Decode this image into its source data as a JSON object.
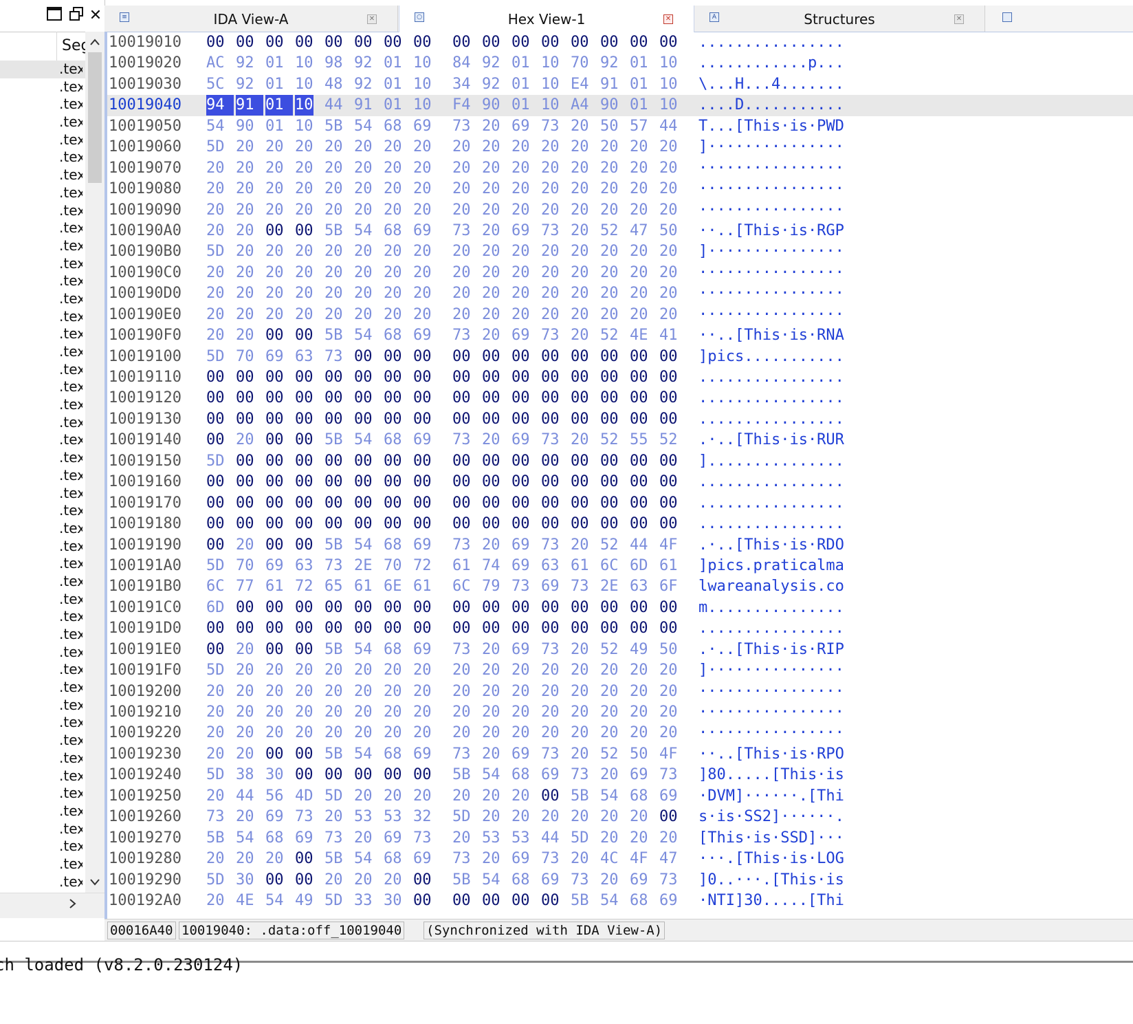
{
  "left_panel": {
    "column_header": "Seg",
    "segment_label": ".tex",
    "row_count": 47,
    "selected_index": 0,
    "toolbar": {
      "window_icon": "window-icon",
      "restore_icon": "restore-icon",
      "close_label": "✕"
    }
  },
  "tabs": [
    {
      "label": "IDA View-A",
      "icon": "disassembly-icon",
      "active": false
    },
    {
      "label": "Hex View-1",
      "icon": "hex-icon",
      "active": true
    },
    {
      "label": "Structures",
      "icon": "structures-icon",
      "active": false
    }
  ],
  "hex_view": {
    "highlighted_address": "10019040",
    "selected_bytes": 4,
    "rows": [
      {
        "addr": "10019010",
        "bytes": "00 00 00 00 00 00 00 00 00 00 00 00 00 00 00 00",
        "ascii": "................"
      },
      {
        "addr": "10019020",
        "bytes": "AC 92 01 10 98 92 01 10 84 92 01 10 70 92 01 10",
        "ascii": "............p..."
      },
      {
        "addr": "10019030",
        "bytes": "5C 92 01 10 48 92 01 10 34 92 01 10 E4 91 01 10",
        "ascii": "\\...H...4......."
      },
      {
        "addr": "10019040",
        "bytes": "94 91 01 10 44 91 01 10 F4 90 01 10 A4 90 01 10",
        "ascii": "....D..........."
      },
      {
        "addr": "10019050",
        "bytes": "54 90 01 10 5B 54 68 69 73 20 69 73 20 50 57 44",
        "ascii": "T...[This·is·PWD"
      },
      {
        "addr": "10019060",
        "bytes": "5D 20 20 20 20 20 20 20 20 20 20 20 20 20 20 20",
        "ascii": "]···············"
      },
      {
        "addr": "10019070",
        "bytes": "20 20 20 20 20 20 20 20 20 20 20 20 20 20 20 20",
        "ascii": "················"
      },
      {
        "addr": "10019080",
        "bytes": "20 20 20 20 20 20 20 20 20 20 20 20 20 20 20 20",
        "ascii": "················"
      },
      {
        "addr": "10019090",
        "bytes": "20 20 20 20 20 20 20 20 20 20 20 20 20 20 20 20",
        "ascii": "················"
      },
      {
        "addr": "100190A0",
        "bytes": "20 20 00 00 5B 54 68 69 73 20 69 73 20 52 47 50",
        "ascii": "··..[This·is·RGP"
      },
      {
        "addr": "100190B0",
        "bytes": "5D 20 20 20 20 20 20 20 20 20 20 20 20 20 20 20",
        "ascii": "]···············"
      },
      {
        "addr": "100190C0",
        "bytes": "20 20 20 20 20 20 20 20 20 20 20 20 20 20 20 20",
        "ascii": "················"
      },
      {
        "addr": "100190D0",
        "bytes": "20 20 20 20 20 20 20 20 20 20 20 20 20 20 20 20",
        "ascii": "················"
      },
      {
        "addr": "100190E0",
        "bytes": "20 20 20 20 20 20 20 20 20 20 20 20 20 20 20 20",
        "ascii": "················"
      },
      {
        "addr": "100190F0",
        "bytes": "20 20 00 00 5B 54 68 69 73 20 69 73 20 52 4E 41",
        "ascii": "··..[This·is·RNA"
      },
      {
        "addr": "10019100",
        "bytes": "5D 70 69 63 73 00 00 00 00 00 00 00 00 00 00 00",
        "ascii": "]pics..........."
      },
      {
        "addr": "10019110",
        "bytes": "00 00 00 00 00 00 00 00 00 00 00 00 00 00 00 00",
        "ascii": "................"
      },
      {
        "addr": "10019120",
        "bytes": "00 00 00 00 00 00 00 00 00 00 00 00 00 00 00 00",
        "ascii": "................"
      },
      {
        "addr": "10019130",
        "bytes": "00 00 00 00 00 00 00 00 00 00 00 00 00 00 00 00",
        "ascii": "................"
      },
      {
        "addr": "10019140",
        "bytes": "00 20 00 00 5B 54 68 69 73 20 69 73 20 52 55 52",
        "ascii": ".·..[This·is·RUR"
      },
      {
        "addr": "10019150",
        "bytes": "5D 00 00 00 00 00 00 00 00 00 00 00 00 00 00 00",
        "ascii": "]..............."
      },
      {
        "addr": "10019160",
        "bytes": "00 00 00 00 00 00 00 00 00 00 00 00 00 00 00 00",
        "ascii": "................"
      },
      {
        "addr": "10019170",
        "bytes": "00 00 00 00 00 00 00 00 00 00 00 00 00 00 00 00",
        "ascii": "................"
      },
      {
        "addr": "10019180",
        "bytes": "00 00 00 00 00 00 00 00 00 00 00 00 00 00 00 00",
        "ascii": "................"
      },
      {
        "addr": "10019190",
        "bytes": "00 20 00 00 5B 54 68 69 73 20 69 73 20 52 44 4F",
        "ascii": ".·..[This·is·RDO"
      },
      {
        "addr": "100191A0",
        "bytes": "5D 70 69 63 73 2E 70 72 61 74 69 63 61 6C 6D 61",
        "ascii": "]pics.praticalma"
      },
      {
        "addr": "100191B0",
        "bytes": "6C 77 61 72 65 61 6E 61 6C 79 73 69 73 2E 63 6F",
        "ascii": "lwareanalysis.co"
      },
      {
        "addr": "100191C0",
        "bytes": "6D 00 00 00 00 00 00 00 00 00 00 00 00 00 00 00",
        "ascii": "m..............."
      },
      {
        "addr": "100191D0",
        "bytes": "00 00 00 00 00 00 00 00 00 00 00 00 00 00 00 00",
        "ascii": "................"
      },
      {
        "addr": "100191E0",
        "bytes": "00 20 00 00 5B 54 68 69 73 20 69 73 20 52 49 50",
        "ascii": ".·..[This·is·RIP"
      },
      {
        "addr": "100191F0",
        "bytes": "5D 20 20 20 20 20 20 20 20 20 20 20 20 20 20 20",
        "ascii": "]···············"
      },
      {
        "addr": "10019200",
        "bytes": "20 20 20 20 20 20 20 20 20 20 20 20 20 20 20 20",
        "ascii": "················"
      },
      {
        "addr": "10019210",
        "bytes": "20 20 20 20 20 20 20 20 20 20 20 20 20 20 20 20",
        "ascii": "················"
      },
      {
        "addr": "10019220",
        "bytes": "20 20 20 20 20 20 20 20 20 20 20 20 20 20 20 20",
        "ascii": "················"
      },
      {
        "addr": "10019230",
        "bytes": "20 20 00 00 5B 54 68 69 73 20 69 73 20 52 50 4F",
        "ascii": "··..[This·is·RPO"
      },
      {
        "addr": "10019240",
        "bytes": "5D 38 30 00 00 00 00 00 5B 54 68 69 73 20 69 73",
        "ascii": "]80.....[This·is"
      },
      {
        "addr": "10019250",
        "bytes": "20 44 56 4D 5D 20 20 20 20 20 20 00 5B 54 68 69",
        "ascii": "·DVM]······.[Thi"
      },
      {
        "addr": "10019260",
        "bytes": "73 20 69 73 20 53 53 32 5D 20 20 20 20 20 20 00",
        "ascii": "s·is·SS2]······."
      },
      {
        "addr": "10019270",
        "bytes": "5B 54 68 69 73 20 69 73 20 53 53 44 5D 20 20 20",
        "ascii": "[This·is·SSD]···"
      },
      {
        "addr": "10019280",
        "bytes": "20 20 20 00 5B 54 68 69 73 20 69 73 20 4C 4F 47",
        "ascii": "···.[This·is·LOG"
      },
      {
        "addr": "10019290",
        "bytes": "5D 30 00 00 20 20 20 00 5B 54 68 69 73 20 69 73",
        "ascii": "]0..···.[This·is"
      },
      {
        "addr": "100192A0",
        "bytes": "20 4E 54 49 5D 33 30 00 00 00 00 00 5B 54 68 69",
        "ascii": "·NTI]30.....[Thi"
      }
    ]
  },
  "status": {
    "file_offset": "00016A40",
    "location": "10019040: .data:off_10019040",
    "sync": "(Synchronized with IDA View-A)"
  },
  "output": {
    "line": "ch loaded (v8.2.0.230124)"
  },
  "colors": {
    "byte_nonzero": "#7b8ddc",
    "byte_zero": "#0c1472",
    "ascii": "#2140d6",
    "selection": "#3c4ee0",
    "accent_border": "#b4c5ea"
  }
}
